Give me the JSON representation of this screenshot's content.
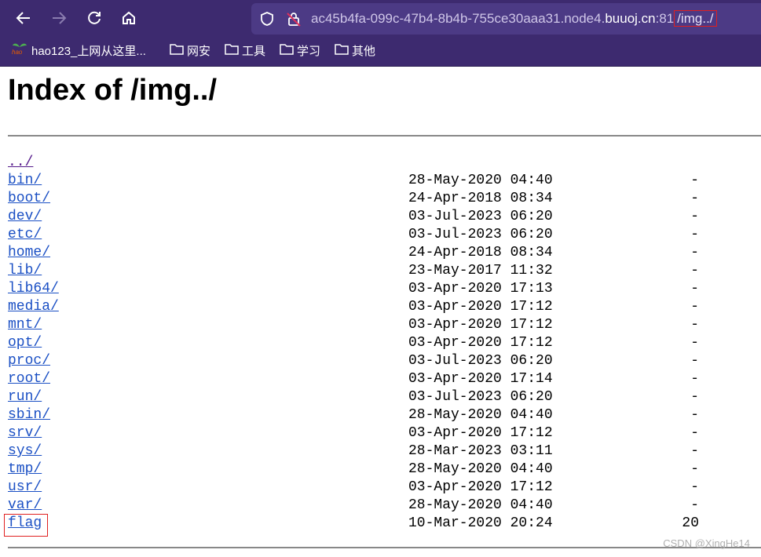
{
  "browser": {
    "url_prefix": "ac45b4fa-099c-47b4-8b4b-755ce30aaa31.node4.",
    "url_host": "buuoj.cn",
    "url_port": ":81",
    "url_path": "/img../",
    "bookmarks": [
      "hao123_上网从这里...",
      "网安",
      "工具",
      "学习",
      "其他"
    ]
  },
  "page": {
    "title": "Index of /img../",
    "parent_link": "../",
    "entries": [
      {
        "name": "bin/",
        "date": "28-May-2020 04:40",
        "size": "-"
      },
      {
        "name": "boot/",
        "date": "24-Apr-2018 08:34",
        "size": "-"
      },
      {
        "name": "dev/",
        "date": "03-Jul-2023 06:20",
        "size": "-"
      },
      {
        "name": "etc/",
        "date": "03-Jul-2023 06:20",
        "size": "-"
      },
      {
        "name": "home/",
        "date": "24-Apr-2018 08:34",
        "size": "-"
      },
      {
        "name": "lib/",
        "date": "23-May-2017 11:32",
        "size": "-"
      },
      {
        "name": "lib64/",
        "date": "03-Apr-2020 17:13",
        "size": "-"
      },
      {
        "name": "media/",
        "date": "03-Apr-2020 17:12",
        "size": "-"
      },
      {
        "name": "mnt/",
        "date": "03-Apr-2020 17:12",
        "size": "-"
      },
      {
        "name": "opt/",
        "date": "03-Apr-2020 17:12",
        "size": "-"
      },
      {
        "name": "proc/",
        "date": "03-Jul-2023 06:20",
        "size": "-"
      },
      {
        "name": "root/",
        "date": "03-Apr-2020 17:14",
        "size": "-"
      },
      {
        "name": "run/",
        "date": "03-Jul-2023 06:20",
        "size": "-"
      },
      {
        "name": "sbin/",
        "date": "28-May-2020 04:40",
        "size": "-"
      },
      {
        "name": "srv/",
        "date": "03-Apr-2020 17:12",
        "size": "-"
      },
      {
        "name": "sys/",
        "date": "28-Mar-2023 03:11",
        "size": "-"
      },
      {
        "name": "tmp/",
        "date": "28-May-2020 04:40",
        "size": "-"
      },
      {
        "name": "usr/",
        "date": "03-Apr-2020 17:12",
        "size": "-"
      },
      {
        "name": "var/",
        "date": "28-May-2020 04:40",
        "size": "-"
      },
      {
        "name": "flag",
        "date": "10-Mar-2020 20:24",
        "size": "20"
      }
    ]
  },
  "watermark": "CSDN @XingHe14",
  "colors": {
    "chrome": "#3d2a6f",
    "link": "#1a4fc4",
    "highlight": "#e02020"
  }
}
